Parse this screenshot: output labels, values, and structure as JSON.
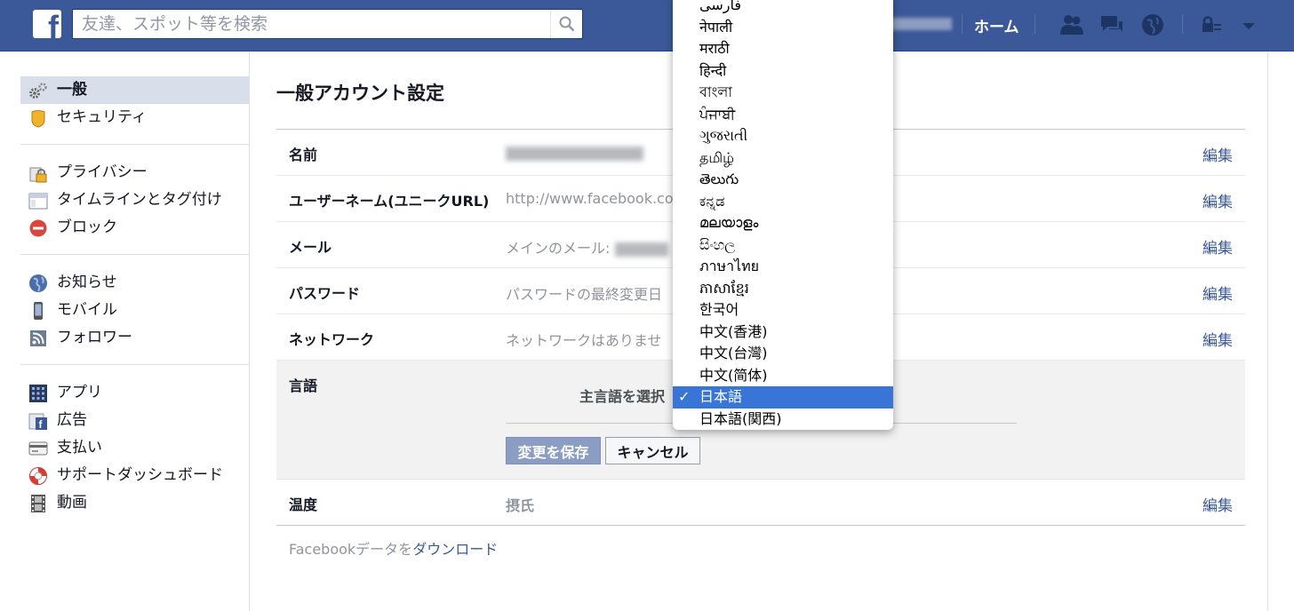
{
  "topbar": {
    "logo": "f",
    "search_placeholder": "友達、スポット等を検索",
    "home_label": "ホーム",
    "icons": [
      "friend-requests-icon",
      "messages-icon",
      "notifications-globe-icon",
      "privacy-shortcut-icon",
      "account-menu-chevron-icon"
    ]
  },
  "sidebar": {
    "groups": [
      [
        {
          "label": "一般",
          "icon": "gears-icon",
          "active": true
        },
        {
          "label": "セキュリティ",
          "icon": "security-badge-icon"
        }
      ],
      [
        {
          "label": "プライバシー",
          "icon": "privacy-lock-icon"
        },
        {
          "label": "タイムラインとタグ付け",
          "icon": "timeline-icon"
        },
        {
          "label": "ブロック",
          "icon": "block-icon"
        }
      ],
      [
        {
          "label": "お知らせ",
          "icon": "globe-icon"
        },
        {
          "label": "モバイル",
          "icon": "mobile-phone-icon"
        },
        {
          "label": "フォロワー",
          "icon": "rss-feed-icon"
        }
      ],
      [
        {
          "label": "アプリ",
          "icon": "apps-grid-icon"
        },
        {
          "label": "広告",
          "icon": "ads-icon"
        },
        {
          "label": "支払い",
          "icon": "credit-card-icon"
        },
        {
          "label": "サポートダッシュボード",
          "icon": "lifebuoy-icon"
        },
        {
          "label": "動画",
          "icon": "film-icon"
        }
      ]
    ]
  },
  "main": {
    "title": "一般アカウント設定",
    "edit_label": "編集",
    "rows": {
      "name": {
        "label": "名前"
      },
      "username": {
        "label": "ユーザーネーム(ユニークURL)",
        "value": "http://www.facebook.com"
      },
      "email": {
        "label": "メール",
        "value": "メインのメール:"
      },
      "password": {
        "label": "パスワード",
        "value": "パスワードの最終変更日"
      },
      "network": {
        "label": "ネットワーク",
        "value": "ネットワークはありませ"
      },
      "language": {
        "label": "言語",
        "primary_prompt": "主言語を選択",
        "save_label": "変更を保存",
        "cancel_label": "キャンセル"
      },
      "temperature": {
        "label": "温度",
        "value": "摂氏"
      }
    },
    "download": {
      "prefix": "Facebookデータを",
      "link": "ダウンロード"
    }
  },
  "language_dropdown": {
    "selected": "日本語",
    "options": [
      "فارسی",
      "नेपाली",
      "मराठी",
      "हिन्दी",
      "বাংলা",
      "ਪੰਜਾਬੀ",
      "ગુજરાતી",
      "தமிழ்",
      "తెలుగు",
      "ಕನ್ನಡ",
      "മലയാളം",
      "සිංහල",
      "ภาษาไทย",
      "ភាសាខ្មែរ",
      "한국어",
      "中文(香港)",
      "中文(台灣)",
      "中文(简体)",
      "日本語",
      "日本語(関西)"
    ]
  },
  "colors": {
    "brand": "#3b5998",
    "link": "#3b5998",
    "selected_option": "#3875d7"
  }
}
